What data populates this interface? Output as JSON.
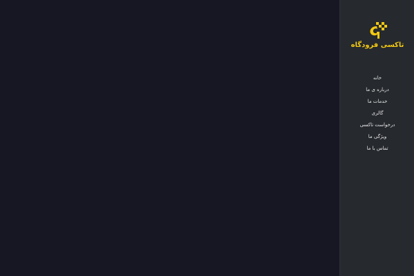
{
  "colors": {
    "main_background": "#161722",
    "sidebar_background": "#26292e",
    "accent": "#f2c811",
    "nav_text": "#e6e6e6"
  },
  "sidebar": {
    "logo": {
      "text": "تاکسی فرودگاه",
      "icon": "taxi-pin-logo-icon"
    },
    "nav_items": [
      {
        "label": "خانه"
      },
      {
        "label": "درباره ی ما"
      },
      {
        "label": "خدمات ما"
      },
      {
        "label": "گالری"
      },
      {
        "label": "درخواست تاکسی"
      },
      {
        "label": "ویژگی ما"
      },
      {
        "label": "تماس با ما"
      }
    ]
  }
}
